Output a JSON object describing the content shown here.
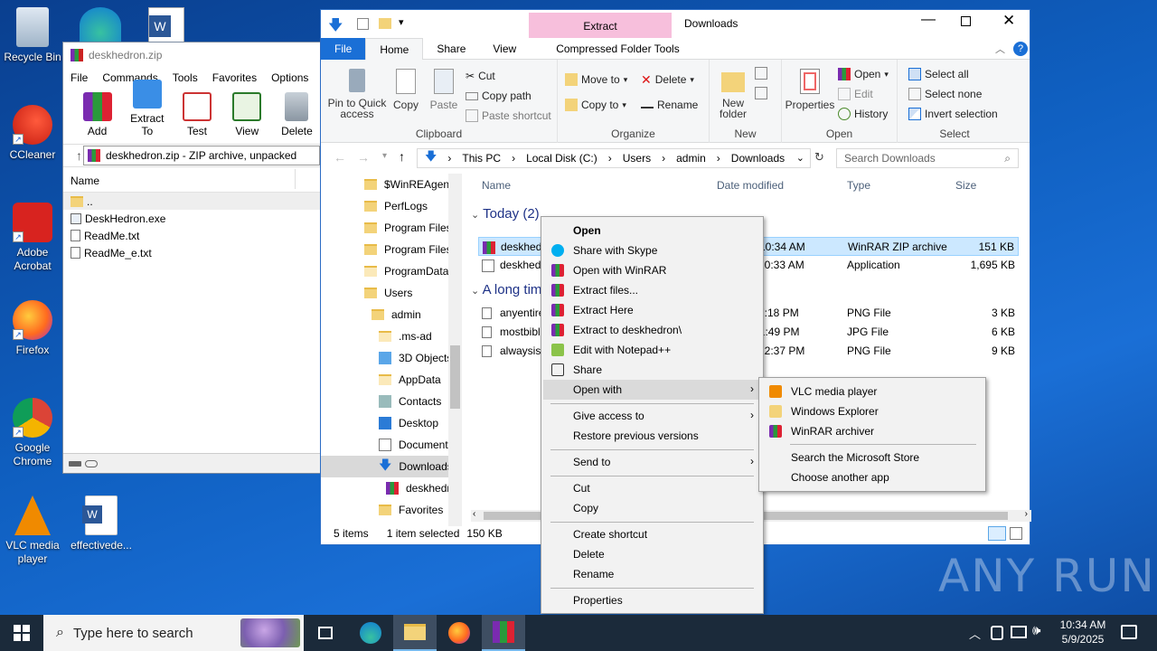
{
  "desktop": {
    "icons": [
      "Recycle Bin",
      "CCleaner",
      "Adobe Acrobat",
      "Firefox",
      "Google Chrome",
      "VLC media player",
      "effectivede..."
    ]
  },
  "winrar": {
    "title": "deskhedron.zip",
    "menu": [
      "File",
      "Commands",
      "Tools",
      "Favorites",
      "Options",
      "He"
    ],
    "toolbar": [
      "Add",
      "Extract To",
      "Test",
      "View",
      "Delete"
    ],
    "path": "deskhedron.zip - ZIP archive, unpacked",
    "column_name": "Name",
    "files": [
      "..",
      "DeskHedron.exe",
      "ReadMe.txt",
      "ReadMe_e.txt"
    ]
  },
  "explorer": {
    "window_title": "Downloads",
    "context_tab": "Extract",
    "tabs": [
      "File",
      "Home",
      "Share",
      "View",
      "Compressed Folder Tools"
    ],
    "ribbon": {
      "clipboard": {
        "pin": "Pin to Quick access",
        "copy": "Copy",
        "paste": "Paste",
        "cut": "Cut",
        "copy_path": "Copy path",
        "paste_shortcut": "Paste shortcut",
        "label": "Clipboard"
      },
      "organize": {
        "move_to": "Move to",
        "copy_to": "Copy to",
        "delete": "Delete",
        "rename": "Rename",
        "label": "Organize"
      },
      "new": {
        "new_folder": "New folder",
        "label": "New"
      },
      "open": {
        "properties": "Properties",
        "open": "Open",
        "edit": "Edit",
        "history": "History",
        "label": "Open"
      },
      "select": {
        "select_all": "Select all",
        "select_none": "Select none",
        "invert": "Invert selection",
        "label": "Select"
      }
    },
    "breadcrumb": [
      "This PC",
      "Local Disk (C:)",
      "Users",
      "admin",
      "Downloads"
    ],
    "search_placeholder": "Search Downloads",
    "nav": [
      "$WinREAgent",
      "PerfLogs",
      "Program Files",
      "Program Files",
      "ProgramData",
      "Users",
      "admin",
      ".ms-ad",
      "3D Objects",
      "AppData",
      "Contacts",
      "Desktop",
      "Documents",
      "Downloads",
      "deskhedr",
      "Favorites"
    ],
    "columns": [
      "Name",
      "Date modified",
      "Type",
      "Size"
    ],
    "groups": [
      "Today (2)",
      "A long time ago (3)"
    ],
    "group2_visible": "A long tim",
    "files": [
      {
        "name": "deskhedr",
        "date": "10:34 AM",
        "type": "WinRAR ZIP archive",
        "size": "151 KB"
      },
      {
        "name": "deskhedr",
        "date": "10:33 AM",
        "type": "Application",
        "size": "1,695 KB"
      },
      {
        "name": "anyentire",
        "date": "7:18 PM",
        "type": "PNG File",
        "size": "3 KB"
      },
      {
        "name": "mostbibl",
        "date": "11:49 PM",
        "type": "JPG File",
        "size": "6 KB"
      },
      {
        "name": "alwaysiss",
        "date": "12:37 PM",
        "type": "PNG File",
        "size": "9 KB"
      }
    ],
    "status": {
      "items": "5 items",
      "selected": "1 item selected",
      "size": "150 KB"
    }
  },
  "context_menu": [
    "Open",
    "Share with Skype",
    "Open with WinRAR",
    "Extract files...",
    "Extract Here",
    "Extract to deskhedron\\",
    "Edit with Notepad++",
    "Share",
    "Open with",
    "Give access to",
    "Restore previous versions",
    "Send to",
    "Cut",
    "Copy",
    "Create shortcut",
    "Delete",
    "Rename",
    "Properties"
  ],
  "open_with_menu": [
    "VLC media player",
    "Windows Explorer",
    "WinRAR archiver",
    "Search the Microsoft Store",
    "Choose another app"
  ],
  "taskbar": {
    "search_placeholder": "Type here to search",
    "time": "10:34 AM",
    "date": "5/9/2025"
  },
  "watermark": "ANY RUN"
}
